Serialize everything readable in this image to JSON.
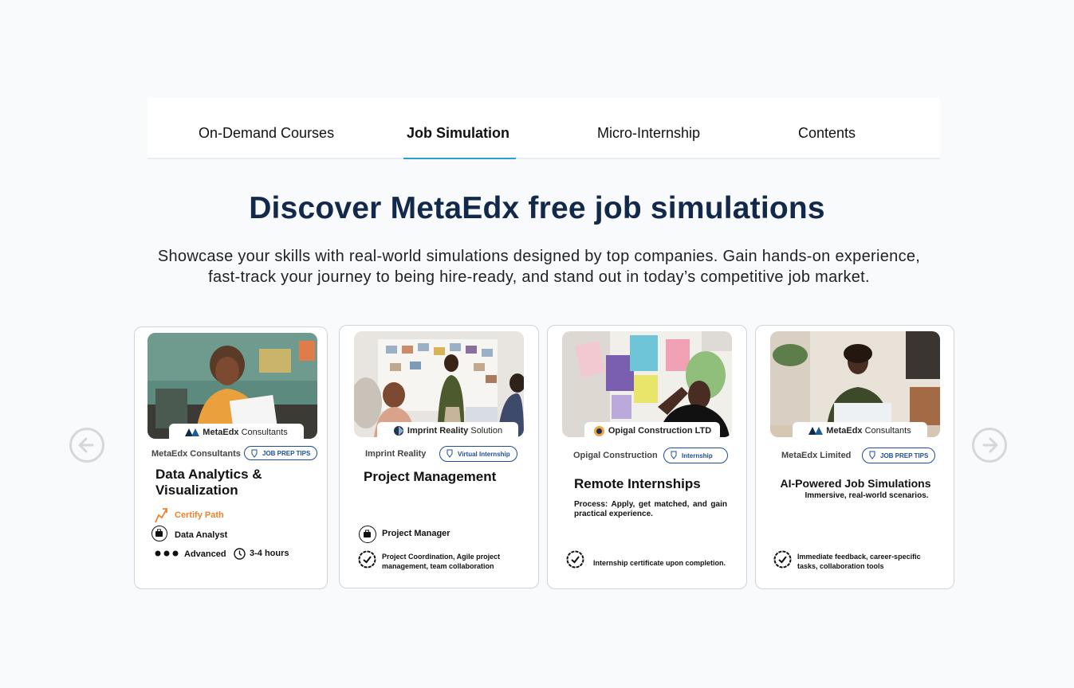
{
  "tabs": [
    {
      "label": "On-Demand Courses"
    },
    {
      "label": "Job Simulation"
    },
    {
      "label": "Micro-Internship"
    },
    {
      "label": "Contents"
    }
  ],
  "heading": "Discover MetaEdx free job simulations",
  "subtitle": "Showcase your skills with real-world simulations designed by top companies. Gain hands-on experience, fast-track your journey to being hire-ready, and stand out in today’s competitive job market.",
  "cards": [
    {
      "logo_bold": "MetaEdx",
      "logo_rest": " Consultants",
      "company": "MetaEdx Consultants",
      "badge": "JOB PREP TIPS",
      "title": "Data Analytics & Visualization",
      "path_label": "Certify Path",
      "role": "Data Analyst",
      "level": "Advanced",
      "duration": "3-4 hours"
    },
    {
      "logo_bold": "Imprint Reality",
      "logo_rest": " Solution",
      "company": "Imprint Reality",
      "badge": "Virtual Internship",
      "title": "Project Management",
      "role": "Project Manager",
      "skills": "Project Coordination, Agile project management, team collaboration"
    },
    {
      "logo_bold": "Opigal Construction LTD",
      "logo_rest": "",
      "company": "Opigal Construction",
      "badge": "Internship",
      "title": "Remote Internships",
      "description": "Process: Apply, get matched, and gain practical experience.",
      "certificate": "Internship certificate upon completion."
    },
    {
      "logo_bold": "MetaEdx",
      "logo_rest": " Consultants",
      "company": "MetaEdx Limited",
      "badge": "JOB PREP TIPS",
      "title": "AI-Powered Job Simulations",
      "tagline": "Immersive, real-world scenarios.",
      "feedback": "Immediate feedback, career-specific tasks, collaboration tools"
    }
  ],
  "colors": {
    "heading": "#13294b",
    "accent_tab": "#2a9fd6",
    "badge": "#1c4e9a",
    "certify": "#f0822d"
  }
}
